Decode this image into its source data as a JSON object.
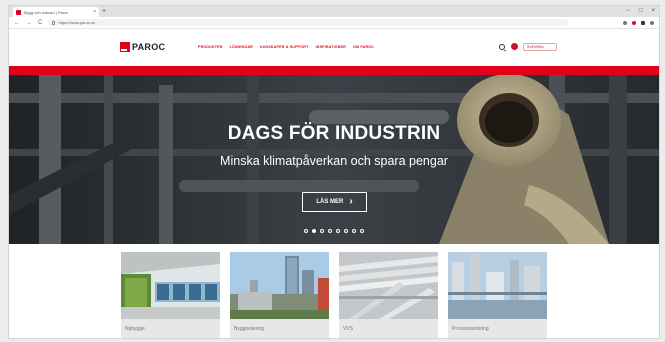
{
  "browser": {
    "tab_title": "Bygg och industri | Paroc",
    "new_tab": "+",
    "close_tab": "×",
    "url": "https://www.paroc.se",
    "back": "←",
    "forward": "→",
    "reload": "C",
    "minimize": "−",
    "maximize": "□",
    "close_window": "×"
  },
  "header": {
    "logo_text": "PAROC",
    "nav": [
      "PRODUKTER",
      "LÖSNINGAR",
      "KUNSKAPER & SUPPORT",
      "INSPIRATIONER",
      "OM PAROC"
    ],
    "language": "SVENSKA"
  },
  "hero": {
    "title": "DAGS FÖR INDUSTRIN",
    "subtitle": "Minska klimatpåverkan och spara pengar",
    "button_label": "LÄS MER",
    "button_chevron": "›",
    "slide_count": 8,
    "active_slide": 2
  },
  "cards": [
    {
      "label": "Nybygge"
    },
    {
      "label": "Byggisolering"
    },
    {
      "label": "VVS"
    },
    {
      "label": "Processisolering"
    }
  ],
  "colors": {
    "brand_red": "#e3001b"
  }
}
